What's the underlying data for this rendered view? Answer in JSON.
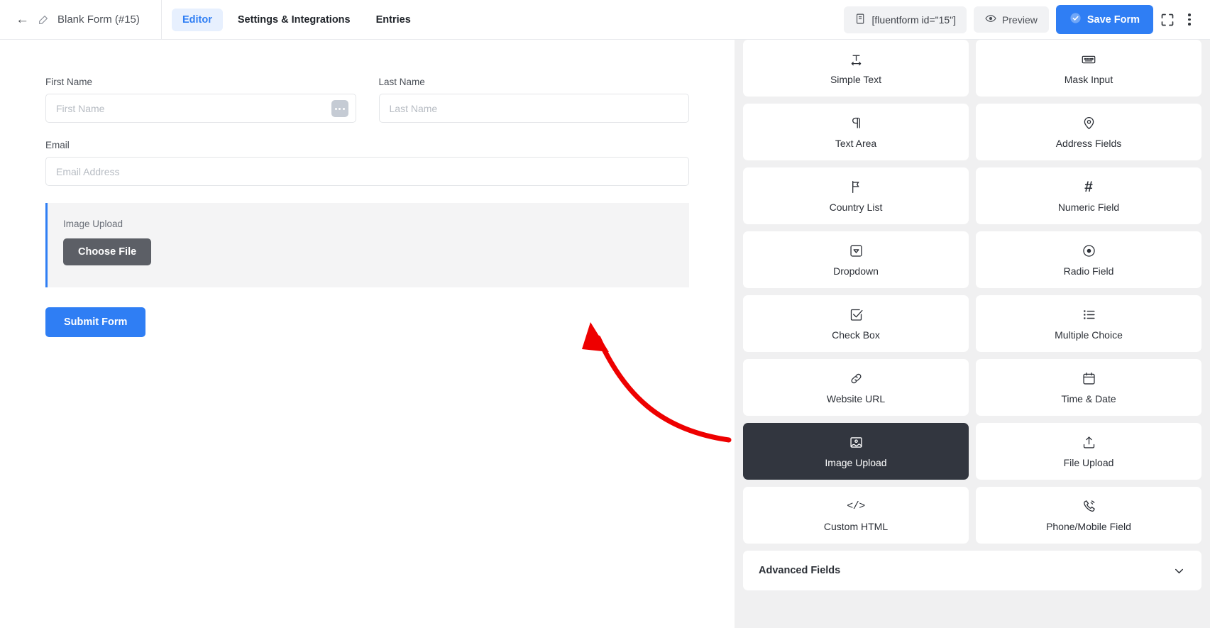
{
  "header": {
    "back_icon": "back-arrow-icon",
    "pencil_icon": "pencil-icon",
    "form_title": "Blank Form (#15)",
    "tabs": [
      {
        "label": "Editor",
        "active": true
      },
      {
        "label": "Settings & Integrations",
        "active": false
      },
      {
        "label": "Entries",
        "active": false
      }
    ],
    "shortcode": {
      "icon": "copy-icon",
      "label": "[fluentform id=\"15\"]"
    },
    "preview": {
      "icon": "eye-icon",
      "label": "Preview"
    },
    "save": {
      "icon": "check-circle-icon",
      "label": "Save Form"
    },
    "fullscreen_icon": "fullscreen-icon",
    "more_icon": "kebab-menu-icon"
  },
  "form": {
    "fields": [
      {
        "label": "First Name",
        "placeholder": "First Name",
        "has_handle": true
      },
      {
        "label": "Last Name",
        "placeholder": "Last Name",
        "has_handle": false
      },
      {
        "label": "Email",
        "placeholder": "Email Address",
        "has_handle": false
      }
    ],
    "upload_block": {
      "label": "Image Upload",
      "button_label": "Choose File"
    },
    "submit_label": "Submit Form"
  },
  "panel": {
    "field_cards": [
      {
        "label": "Simple Text",
        "icon": "text-width-icon",
        "selected": false
      },
      {
        "label": "Mask Input",
        "icon": "keyboard-icon",
        "selected": false
      },
      {
        "label": "Text Area",
        "icon": "paragraph-icon",
        "selected": false
      },
      {
        "label": "Address Fields",
        "icon": "map-pin-icon",
        "selected": false
      },
      {
        "label": "Country List",
        "icon": "flag-icon",
        "selected": false
      },
      {
        "label": "Numeric Field",
        "icon": "hash-icon",
        "selected": false
      },
      {
        "label": "Dropdown",
        "icon": "dropdown-icon",
        "selected": false
      },
      {
        "label": "Radio Field",
        "icon": "radio-icon",
        "selected": false
      },
      {
        "label": "Check Box",
        "icon": "checkbox-icon",
        "selected": false
      },
      {
        "label": "Multiple Choice",
        "icon": "list-icon",
        "selected": false
      },
      {
        "label": "Website URL",
        "icon": "link-icon",
        "selected": false
      },
      {
        "label": "Time & Date",
        "icon": "calendar-icon",
        "selected": false
      },
      {
        "label": "Image Upload",
        "icon": "image-icon",
        "selected": true
      },
      {
        "label": "File Upload",
        "icon": "upload-icon",
        "selected": false
      },
      {
        "label": "Custom HTML",
        "icon": "code-icon",
        "selected": false
      },
      {
        "label": "Phone/Mobile Field",
        "icon": "phone-icon",
        "selected": false
      }
    ],
    "advanced": {
      "label": "Advanced Fields",
      "chevron_icon": "chevron-down-icon"
    }
  },
  "annotation": {
    "arrow_color": "#ee0000",
    "name": "red-pointer-arrow"
  }
}
